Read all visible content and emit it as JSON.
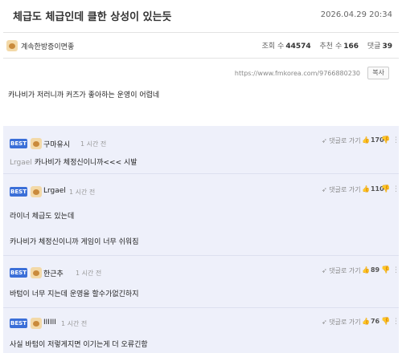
{
  "post": {
    "title": "체급도 체급인데 클한 상성이 있는듯",
    "datetime": "2026.04.29 20:34",
    "author": "계속한방증이면좋",
    "views_label": "조회 수",
    "views": "44574",
    "recommend_label": "추천 수",
    "recommend": "166",
    "comments_label": "댓글",
    "comments": "39",
    "url": "https://www.fmkorea.com/9766880230",
    "copy_label": "복사",
    "body": "카나비가 저러니까 커즈가 좋아하는 운영이 어렵네"
  },
  "comments": [
    {
      "badge": "BEST",
      "author": "구마유시",
      "time": "1 시간 전",
      "reply_label": "댓글로 가기",
      "likes": "170",
      "mention": "Lrgael",
      "text": "카나비가 체정신이니까<<< 시발"
    },
    {
      "badge": "BEST",
      "author": "Lrgael",
      "time": "1 시간 전",
      "reply_label": "댓글로 가기",
      "likes": "110",
      "line1": "라이너 체급도 있는데",
      "line2": "카나비가 체정신이니까 게임이 너무 쉬워짐"
    },
    {
      "badge": "BEST",
      "author": "한근추",
      "time": "1 시간 전",
      "reply_label": "댓글로 가기",
      "likes": "89",
      "text": "바텀이 너무 지는데 운영을 할수가없긴하지"
    },
    {
      "badge": "BEST",
      "author": "IIIIII",
      "time": "1 시간 전",
      "reply_label": "댓글로 가기",
      "likes": "76",
      "text": "사실 바텀이 저렇게지면 이기는게 더 오류긴함"
    }
  ],
  "icons": {
    "reply": "reply-arrow-icon",
    "like": "thumbs-up-icon",
    "dislike": "thumbs-down-icon",
    "more": "more-vertical-icon"
  },
  "colors": {
    "best_badge": "#3b6fd8",
    "comment_bg": "#eef0fa"
  }
}
